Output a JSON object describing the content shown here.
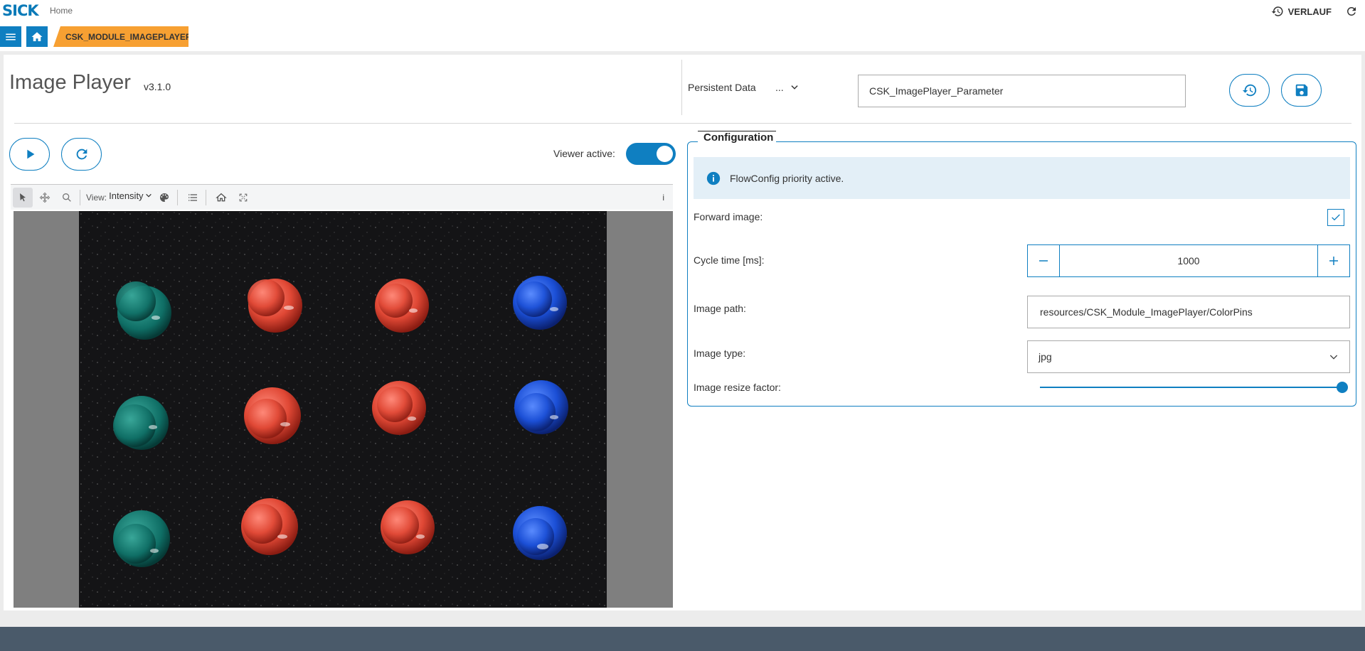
{
  "header": {
    "logo": "SICK",
    "home_link": "Home",
    "history_label": "VERLAUF",
    "module_tab": "CSK_MODULE_IMAGEPLAYER"
  },
  "page": {
    "title": "Image Player",
    "version": "v3.1.0",
    "persistent_label": "Persistent Data",
    "persistent_dots": "...",
    "persistent_value": "CSK_ImagePlayer_Parameter"
  },
  "viewer": {
    "active_label": "Viewer active:",
    "active": true,
    "view_label": "View:",
    "view_mode": "Intensity",
    "info": "i"
  },
  "config": {
    "legend": "Configuration",
    "info_text": "FlowConfig priority active.",
    "forward_label": "Forward image:",
    "forward_checked": true,
    "cycle_label": "Cycle time [ms]:",
    "cycle_value": "1000",
    "path_label": "Image path:",
    "path_value": "resources/CSK_Module_ImagePlayer/ColorPins",
    "type_label": "Image type:",
    "type_value": "jpg",
    "resize_label": "Image resize factor:",
    "resize_fraction": 1.0
  },
  "colors": {
    "accent": "#0f7fc1",
    "tab": "#f7a032",
    "footer": "#4a5a6a"
  }
}
